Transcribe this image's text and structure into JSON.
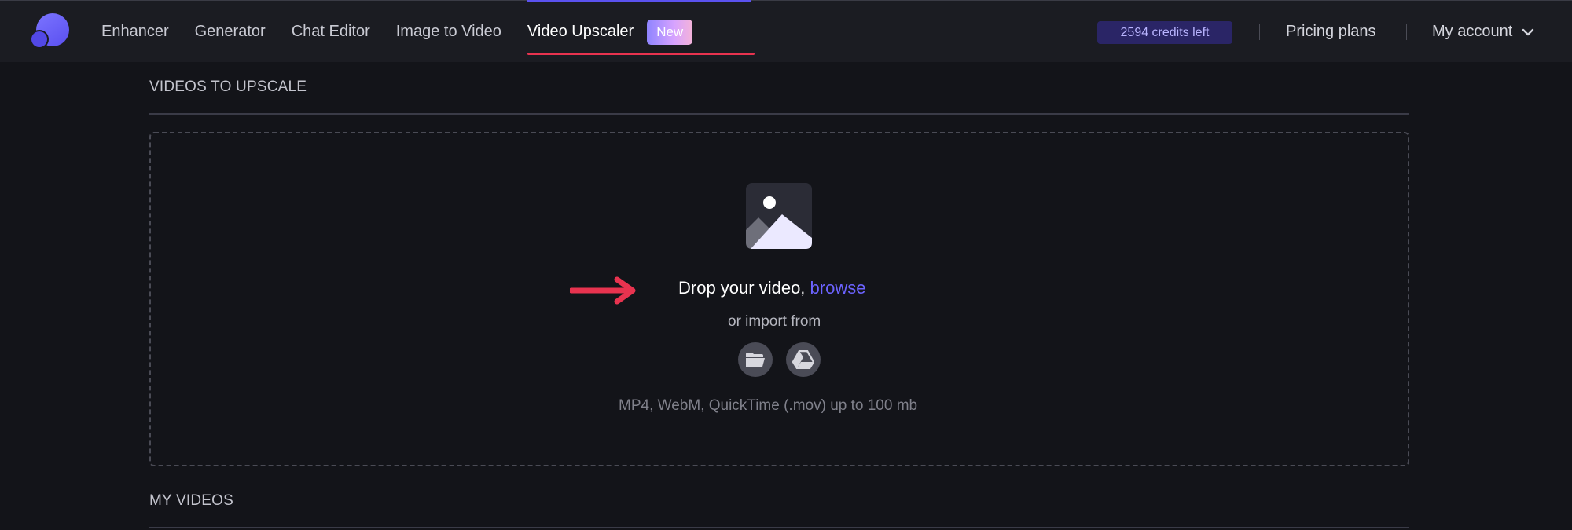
{
  "nav": {
    "items": [
      {
        "label": "Enhancer"
      },
      {
        "label": "Generator"
      },
      {
        "label": "Chat Editor"
      },
      {
        "label": "Image to Video"
      },
      {
        "label": "Video Upscaler"
      }
    ],
    "new_badge": "New",
    "active_index": 4
  },
  "header": {
    "credits": "2594 credits left",
    "pricing": "Pricing plans",
    "account": "My account"
  },
  "upscale_section": {
    "title": "VIDEOS TO UPSCALE",
    "drop_text": "Drop your video,",
    "browse": "browse",
    "import_text": "or import from",
    "formats": "MP4, WebM, QuickTime (.mov) up to 100 mb"
  },
  "my_videos_section": {
    "title": "MY VIDEOS"
  },
  "colors": {
    "accent": "#5b52f0",
    "active_underline": "#e8334f",
    "arrow": "#e8334f",
    "browse_link": "#6c63ff"
  },
  "icons": {
    "logo": "logo-icon",
    "upload": "image-placeholder-icon",
    "folder": "folder-icon",
    "drive": "google-drive-icon",
    "chevron": "chevron-down-icon"
  }
}
